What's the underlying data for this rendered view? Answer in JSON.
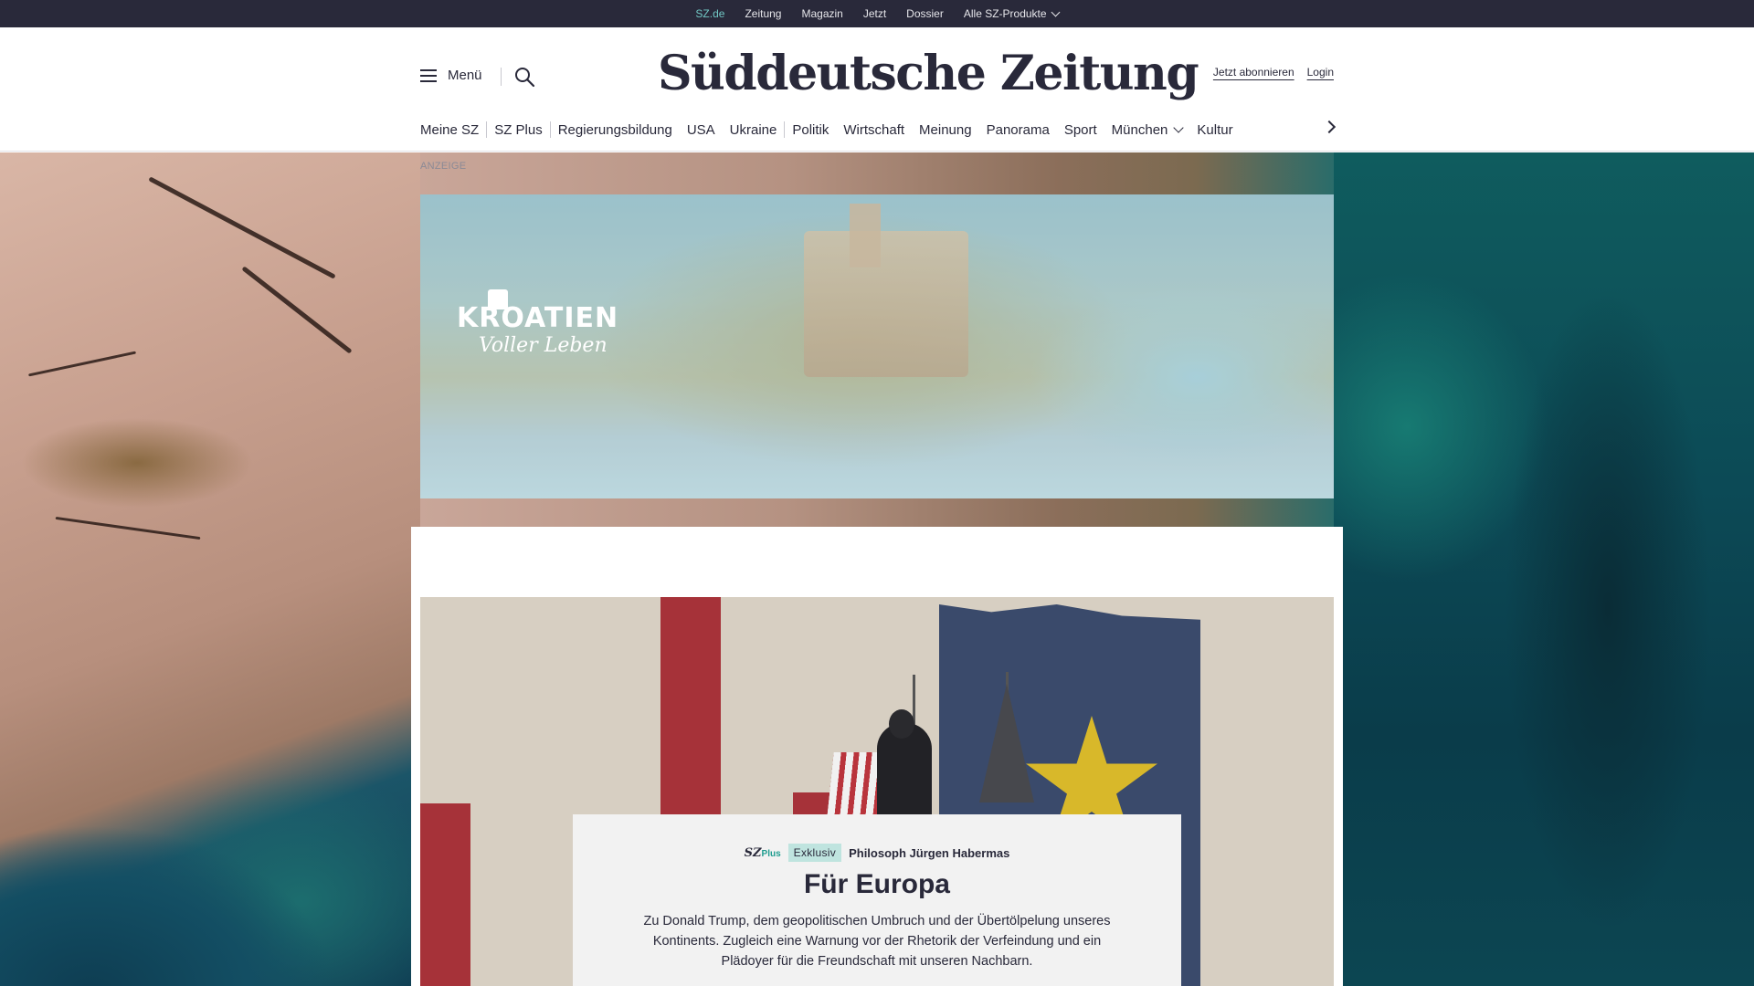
{
  "topbar": {
    "items": [
      "SZ.de",
      "Zeitung",
      "Magazin",
      "Jetzt",
      "Dossier",
      "Alle SZ-Produkte"
    ],
    "active": "SZ.de"
  },
  "header": {
    "menu_label": "Menü",
    "logo": "Süddeutsche Zeitung",
    "subscribe": "Jetzt abonnieren",
    "login": "Login"
  },
  "nav": {
    "items": [
      "Meine SZ",
      "SZ Plus",
      "Regierungsbildung",
      "USA",
      "Ukraine",
      "Politik",
      "Wirtschaft",
      "Meinung",
      "Panorama",
      "Sport",
      "München",
      "Kultur"
    ]
  },
  "ad": {
    "label": "ANZEIGE",
    "brand_line1": "KROATIEN",
    "brand_line2": "Voller Leben"
  },
  "article": {
    "brand": "SZ",
    "brand_plus": "Plus",
    "badge": "Exklusiv",
    "kicker": "Philosoph Jürgen Habermas",
    "headline": "Für Europa",
    "teaser": "Zu Donald Trump, dem geopolitischen Umbruch und der Übertölpelung unseres Kontinents. Zugleich eine Warnung vor der Rhetorik der Verfeindung und ein Plädoyer für die Freundschaft mit unseren Nachbarn."
  },
  "colors": {
    "brand_dark": "#29293a",
    "accent_teal": "#71c7c4",
    "badge_bg": "#bfe4df",
    "hero_red": "#a63239",
    "hero_blue": "#3a4a6b",
    "hero_gold": "#d8b82a"
  },
  "icons": {
    "menu": "hamburger-icon",
    "search": "search-icon",
    "dropdown": "chevron-down-icon",
    "nav_next": "chevron-right-icon"
  }
}
